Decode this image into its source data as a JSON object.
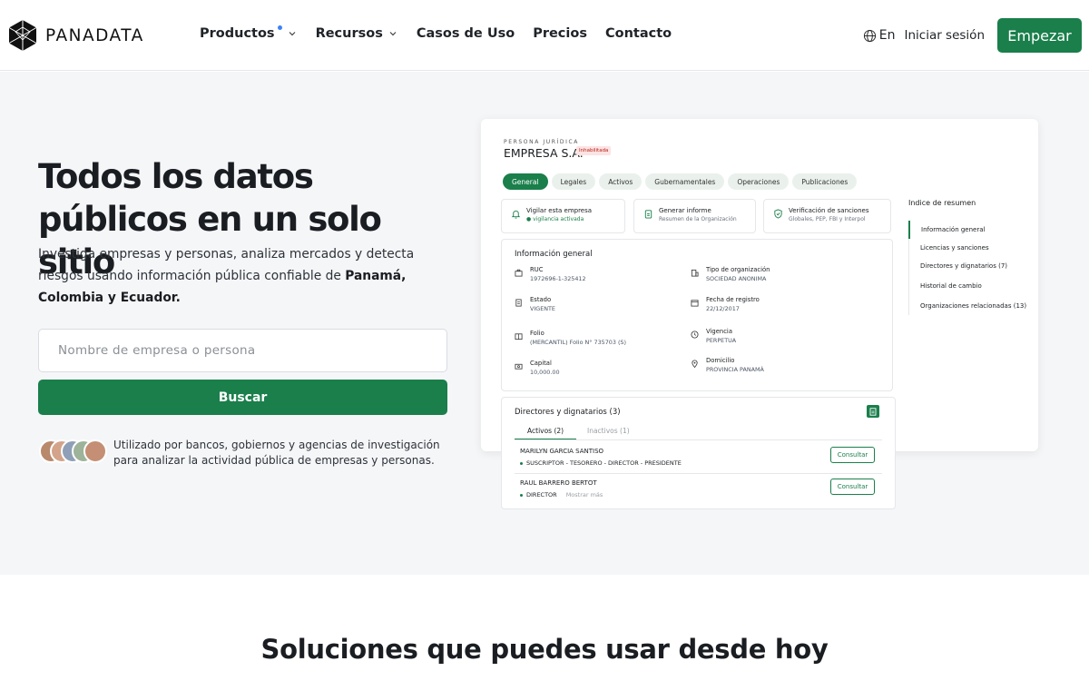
{
  "brand": {
    "name": "PANADATA",
    "icon": "hexagon-logo-icon"
  },
  "nav": {
    "items": [
      {
        "label": "Productos",
        "has_dot": true,
        "has_chevron": true
      },
      {
        "label": "Recursos",
        "has_chevron": true
      },
      {
        "label": "Casos de Uso"
      },
      {
        "label": "Precios"
      },
      {
        "label": "Contacto"
      }
    ],
    "language": "En",
    "login": "Iniciar sesión",
    "cta": "Empezar"
  },
  "hero": {
    "title": "Todos los datos públicos en un solo sitio",
    "subtitle_prefix": "Investiga empresas y personas, analiza mercados y detecta riesgos usando información pública confiable de ",
    "subtitle_countries": "Panamá, Colombia y Ecuador.",
    "search_placeholder": "Nombre de empresa o persona",
    "search_button": "Buscar",
    "trust_text": "Utilizado por bancos, gobiernos y agencias de investigación para analizar la actividad pública de empresas y personas."
  },
  "mock": {
    "kind": "PERSONA JURÍDICA",
    "company": "EMPRESA S.A.",
    "badge": "Inhabilitada",
    "tabs": [
      "General",
      "Legales",
      "Activos",
      "Gubernamentales",
      "Operaciones",
      "Publicaciones"
    ],
    "actions": [
      {
        "title": "Vigilar esta empresa",
        "subtitle": "vigilancia activada",
        "icon": "bell-icon"
      },
      {
        "title": "Generar informe",
        "subtitle": "Resumen de la Organización",
        "icon": "report-icon"
      },
      {
        "title": "Verificación de sanciones",
        "subtitle": "Globales, PEP, FBI y Interpol",
        "icon": "shield-icon"
      }
    ],
    "info_title": "Información general",
    "fields": [
      {
        "label": "RUC",
        "value": "1972696-1-325412"
      },
      {
        "label": "Tipo de organización",
        "value": "SOCIEDAD ANONIMA"
      },
      {
        "label": "Estado",
        "value": "VIGENTE"
      },
      {
        "label": "Fecha de registro",
        "value": "22/12/2017"
      },
      {
        "label": "Folio",
        "value": "(MERCANTIL) Folio N° 735703 (S)"
      },
      {
        "label": "Vigencia",
        "value": "PERPETUA"
      },
      {
        "label": "Capital",
        "value": "10,000.00"
      },
      {
        "label": "Domicilio",
        "value": "PROVINCIA PANAMÁ"
      }
    ],
    "index_title": "Indice de resumen",
    "index": [
      "Información general",
      "Licencias y sanciones",
      "Directores y dignatarios (7)",
      "Historial de cambio",
      "Organizaciones relacionadas (13)"
    ],
    "directors": {
      "title": "Directores y dignatarios (3)",
      "tab_active": "Activos (2)",
      "tab_inactive": "Inactivos (1)",
      "rows": [
        {
          "name": "MARILYN GARCIA SANTISO",
          "role": "SUSCRIPTOR - TESORERO - DIRECTOR - PRESIDENTE",
          "button": "Consultar"
        },
        {
          "name": "RAUL BARRERO BERTOT",
          "role": "DIRECTOR",
          "more": "Mostrar más",
          "button": "Consultar"
        }
      ]
    }
  },
  "solutions": {
    "title": "Soluciones que puedes usar desde hoy"
  }
}
